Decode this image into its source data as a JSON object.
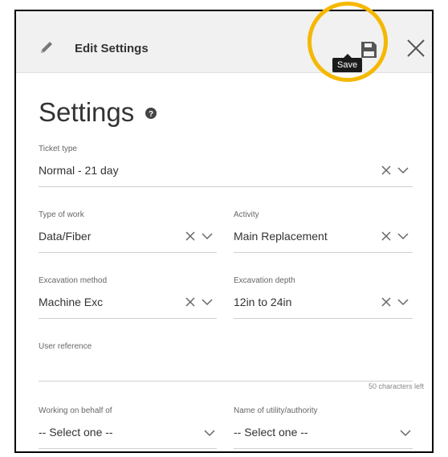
{
  "header": {
    "title": "Edit Settings",
    "save_tooltip": "Save"
  },
  "page": {
    "title": "Settings"
  },
  "fields": {
    "ticket_type": {
      "label": "Ticket type",
      "value": "Normal - 21 day"
    },
    "type_of_work": {
      "label": "Type of work",
      "value": "Data/Fiber"
    },
    "activity": {
      "label": "Activity",
      "value": "Main Replacement"
    },
    "excavation_method": {
      "label": "Excavation method",
      "value": "Machine Exc"
    },
    "excavation_depth": {
      "label": "Excavation depth",
      "value": "12in to 24in"
    },
    "user_reference": {
      "label": "User reference",
      "value": "",
      "counter": "50 characters left"
    },
    "working_on_behalf_of": {
      "label": "Working on behalf of",
      "value": "-- Select one --"
    },
    "utility_authority": {
      "label": "Name of utility/authority",
      "value": "-- Select one --"
    }
  },
  "colors": {
    "highlight": "#f5b800",
    "header_bg": "#f1f1f1"
  },
  "icons": [
    "pencil-icon",
    "save-icon",
    "close-icon",
    "help-icon",
    "clear-icon",
    "chevron-down-icon"
  ]
}
